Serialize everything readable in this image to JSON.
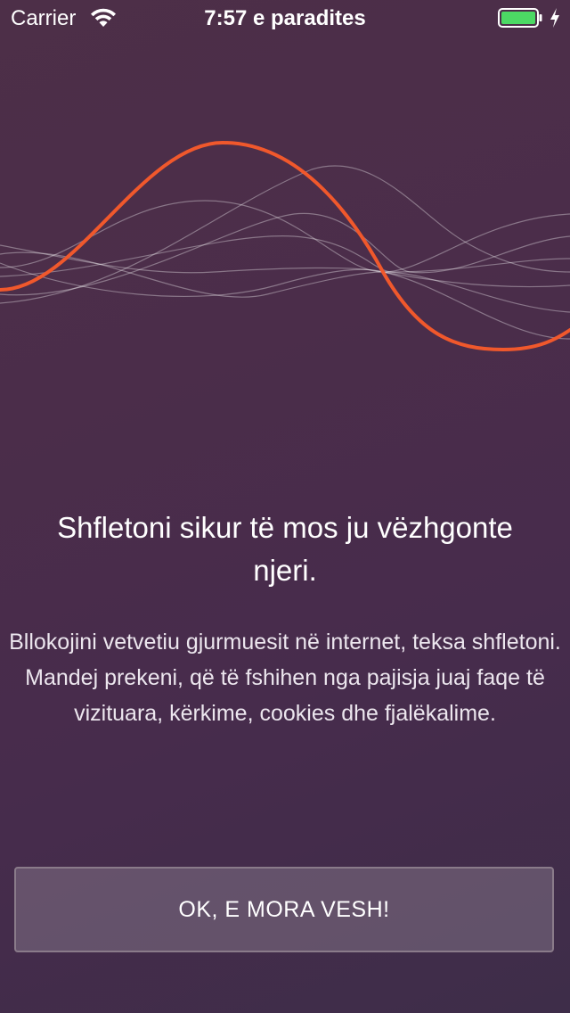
{
  "status_bar": {
    "carrier": "Carrier",
    "time": "7:57 e paradites",
    "battery_color": "#4cd964"
  },
  "illustration": {
    "accent_wave_color": "#f0582c",
    "secondary_wave_color": "#ffffff"
  },
  "content": {
    "headline": "Shfletoni sikur të mos ju vëzhgonte njeri.",
    "description": "Bllokojini vetvetiu gjurmuesit në internet, teksa shfletoni. Mandej prekeni, që të fshihen nga pajisja juaj faqe të vizituara, kërkime, cookies dhe fjalëkalime."
  },
  "actions": {
    "ok_label": "OK, E MORA VESH!"
  }
}
